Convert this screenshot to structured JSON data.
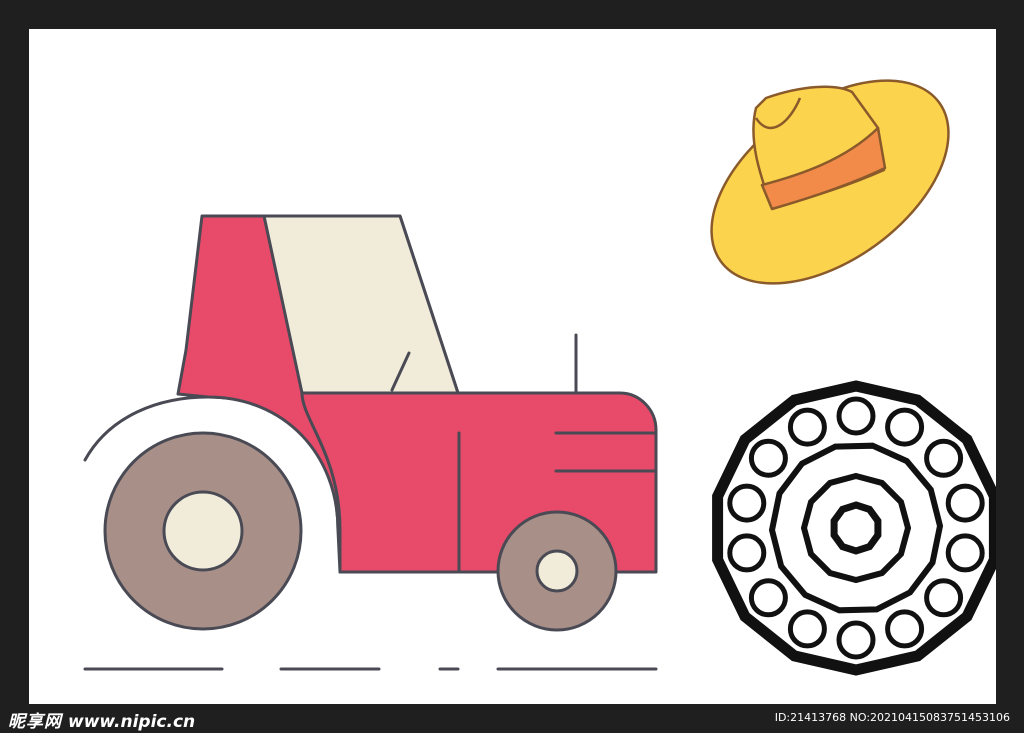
{
  "watermark": {
    "brand": "昵享网",
    "url": "www.nipic.cn"
  },
  "image_id": "ID:21413768 NO:20210415083751453106",
  "colors": {
    "frame": "#1f1f1f",
    "background": "#ffffff",
    "tractor_body": "#e84a6a",
    "cab_window": "#f1ebda",
    "tire": "#a89089",
    "hub": "#f1ebda",
    "outline": "#4a4a55",
    "hat": "#fcd34d",
    "hat_band": "#f28b4a",
    "hat_outline": "#8a5a2b",
    "wheel_icon": "#111111"
  },
  "icons": [
    "tractor-icon",
    "straw-hat-icon",
    "tractor-wheel-icon"
  ]
}
